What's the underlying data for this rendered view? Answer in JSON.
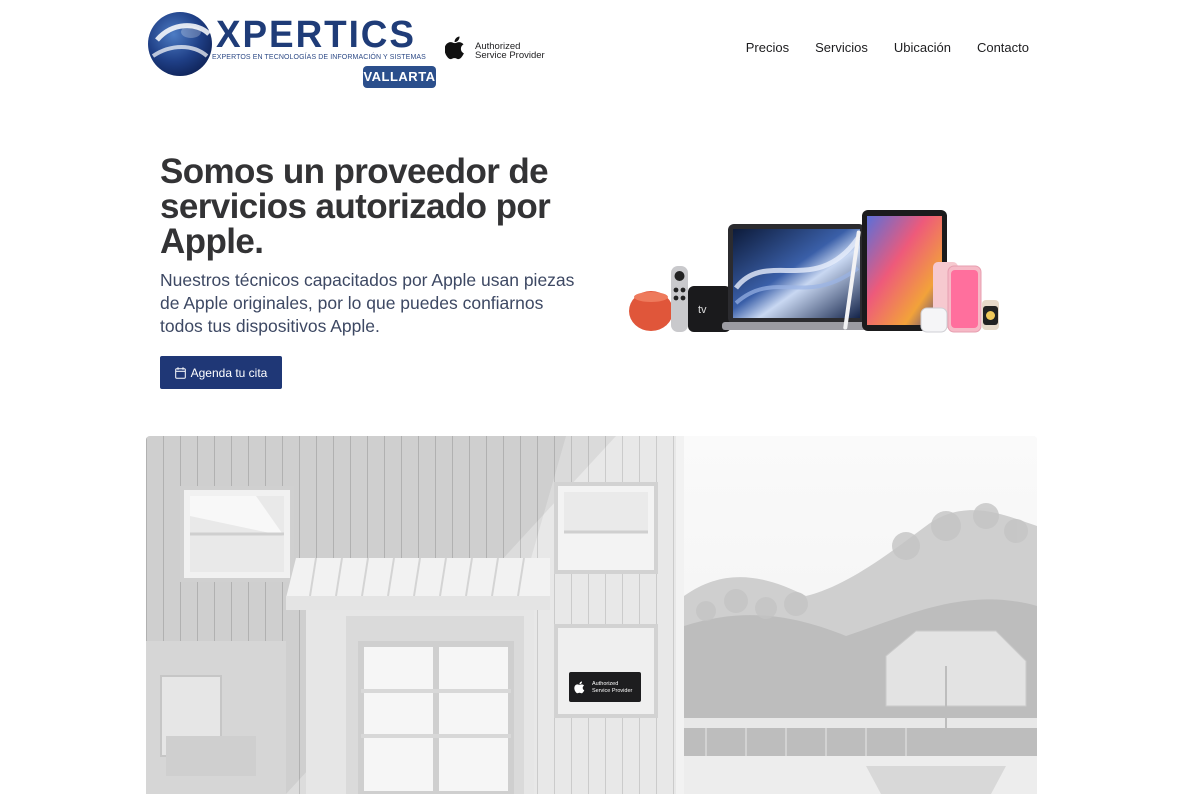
{
  "header": {
    "logo": {
      "wordmark": "XPERTICS",
      "tagline": "EXPERTOS EN TECNOLOGÍAS DE INFORMACIÓN Y SISTEMAS",
      "city": "VALLARTA"
    },
    "partner_badge": {
      "icon": "apple-logo-icon",
      "line1": "Authorized",
      "line2": "Service Provider"
    },
    "nav": [
      "Precios",
      "Servicios",
      "Ubicación",
      "Contacto"
    ]
  },
  "hero": {
    "title": "Somos un proveedor de servicios autorizado por Apple.",
    "description": "Nuestros técnicos capacitados por Apple usan piezas de Apple originales, por lo que puedes confiarnos todos tus dispositivos Apple.",
    "cta": {
      "label": "Agenda tu cita",
      "icon": "calendar-icon"
    },
    "devices_image": {
      "tv_label": "tv"
    }
  },
  "banner": {
    "sign_line1": "Authorized",
    "sign_line2": "Service Provider"
  },
  "colors": {
    "brand_navy": "#1f3776",
    "logo_blue": "#1f3c78",
    "text_dark": "#333335",
    "text_body": "#3d4863"
  }
}
